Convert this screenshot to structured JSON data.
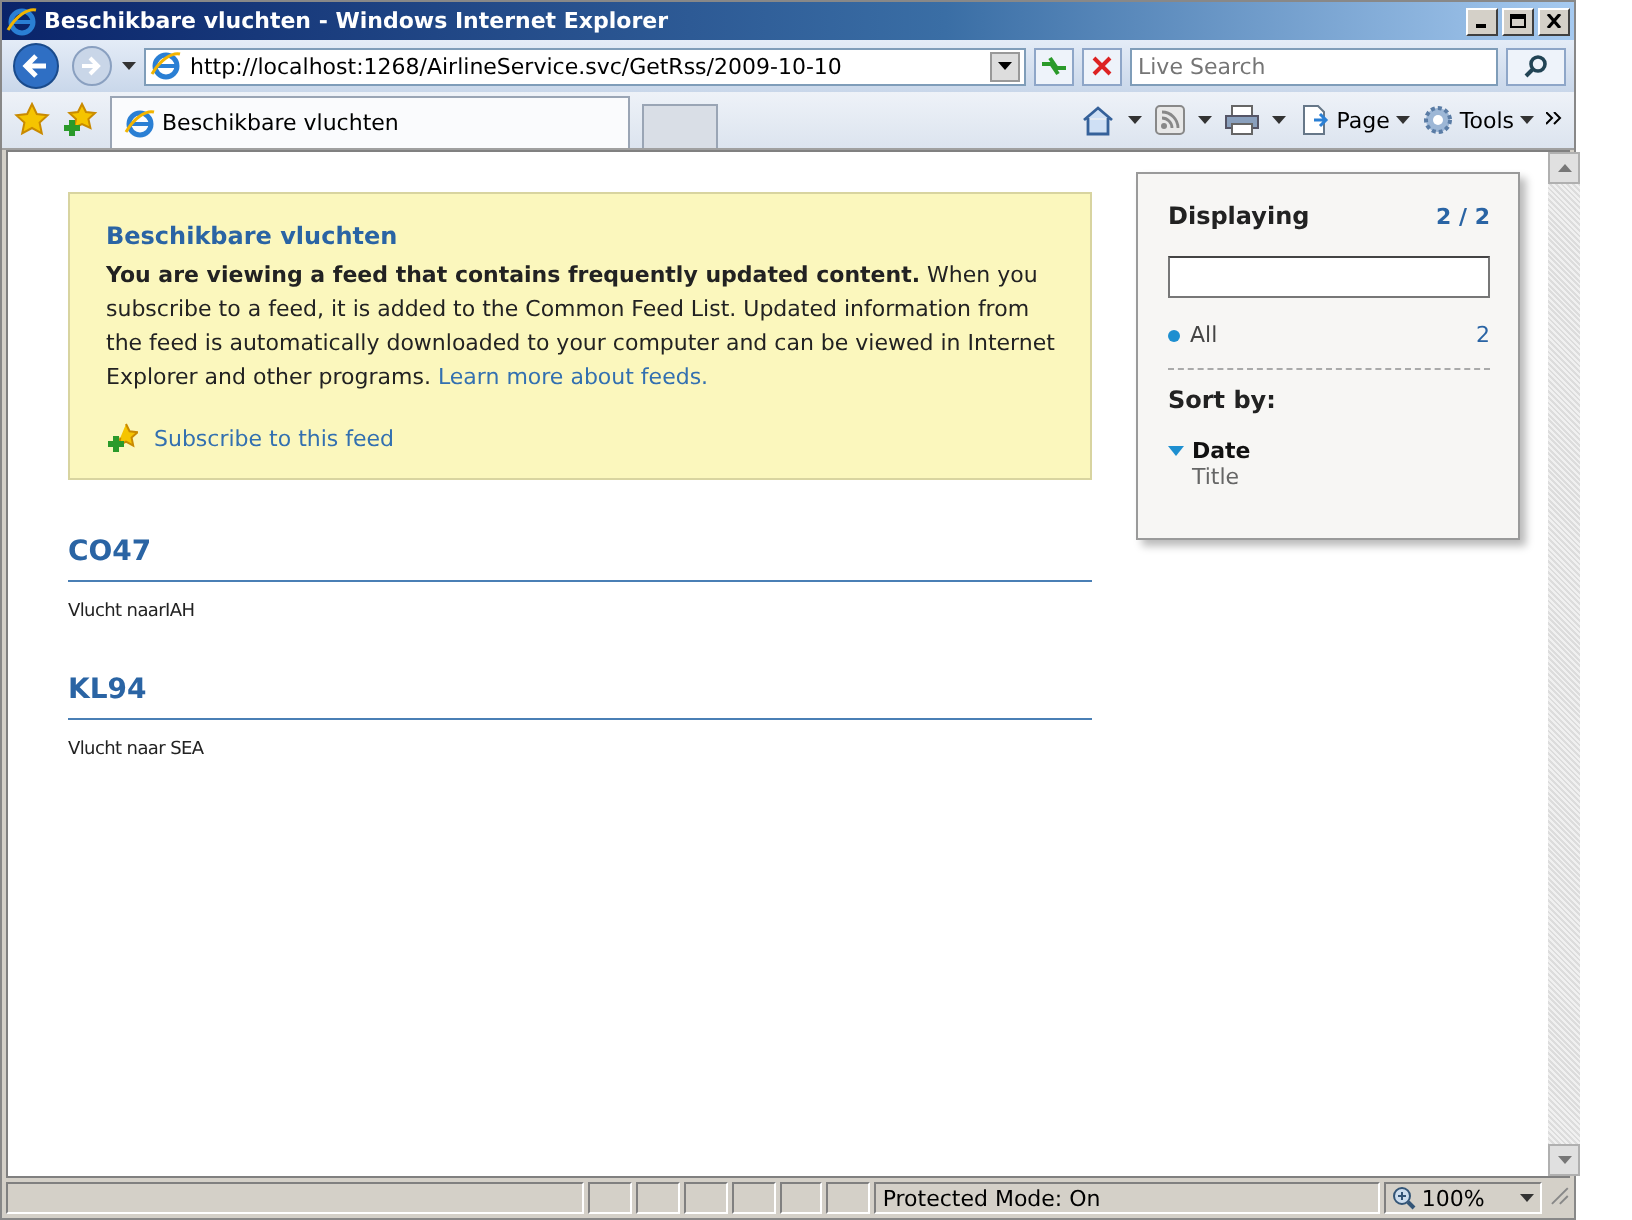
{
  "window": {
    "title": "Beschikbare vluchten - Windows Internet Explorer"
  },
  "address_bar": {
    "value": "http://localhost:1268/AirlineService.svc/GetRss/2009-10-10"
  },
  "search": {
    "placeholder": "Live Search"
  },
  "tabs": [
    {
      "label": "Beschikbare vluchten",
      "selected": true
    }
  ],
  "command_bar": [
    {
      "label": "Page"
    },
    {
      "label": "Tools"
    }
  ],
  "feed": {
    "title": "Beschikbare vluchten",
    "description": "**You are viewing a feed that contains frequently updated content.** When you subscribe to a feed, it is added to the Common Feed List. Updated information from the feed is automatically downloaded to your computer and can be viewed in Internet Explorer and other programs.",
    "link": "Learn more about feeds.",
    "subscribe": "Subscribe to this feed"
  },
  "items": [
    {
      "title": "CO47",
      "text": "Vlucht naarIAH"
    },
    {
      "title": "KL94",
      "text": "Vlucht naar SEA"
    }
  ],
  "sidebar": {
    "heading": "Displaying",
    "count": "2 / 2",
    "filters": [
      {
        "label": "All",
        "count": "2",
        "selected": true
      }
    ],
    "sort_heading": "Sort by:",
    "sort": [
      {
        "label": "Date",
        "selected": true
      },
      {
        "label": "Title",
        "selected": false
      }
    ]
  },
  "status_bar": {
    "text": "Protected Mode: On",
    "zoom": "100%"
  }
}
